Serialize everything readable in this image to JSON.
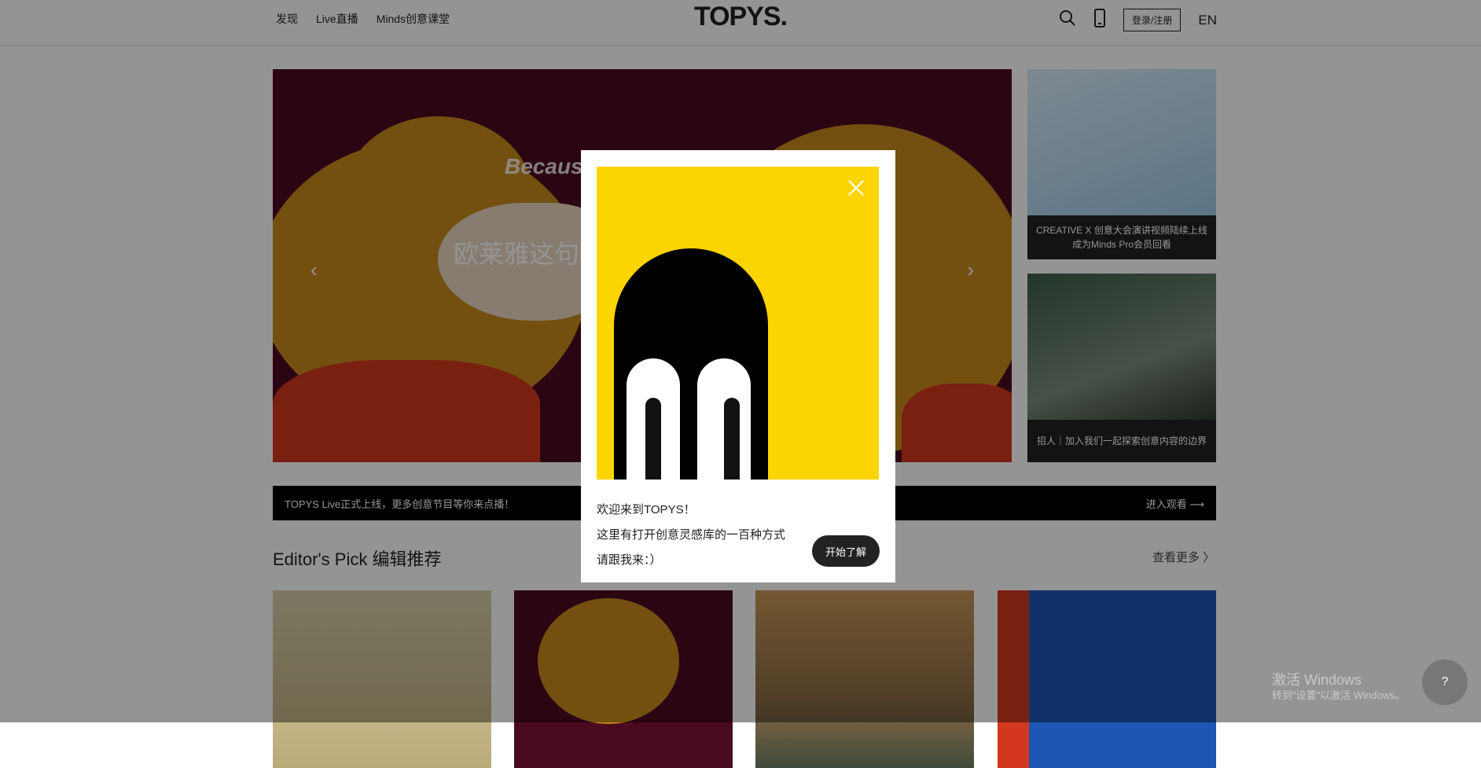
{
  "header": {
    "nav": [
      "发现",
      "Live直播",
      "Minds创意课堂"
    ],
    "logo": "TOPYS.",
    "login_label": "登录/注册",
    "lang_label": "EN",
    "icons": [
      "search-icon",
      "mobile-icon"
    ]
  },
  "banner": {
    "title": "欧莱雅这句",
    "word": "Becaus",
    "prev": "‹",
    "next": "›"
  },
  "side": [
    {
      "caption": "CREATIVE X 创意大会演讲视频陆续上线\n成为Minds Pro会员回看"
    },
    {
      "caption": "招人｜加入我们一起探索创意内容的边界"
    }
  ],
  "live_bar": {
    "text": "TOPYS Live正式上线，更多创意节目等你来点播！",
    "action": "进入观看"
  },
  "editors_pick": {
    "title": "Editor's Pick 编辑推荐",
    "more": "查看更多"
  },
  "modal": {
    "line1": "欢迎来到TOPYS！",
    "line2": "这里有打开创意灵感库的一百种方式",
    "line3": "请跟我来：）",
    "button": "开始了解",
    "colors": {
      "bg": "#fcd500",
      "shape": "#000000"
    }
  },
  "watermark": {
    "line1": "激活 Windows",
    "line2": "转到\"设置\"以激活 Windows。"
  },
  "help_bot": {
    "label": "?"
  }
}
